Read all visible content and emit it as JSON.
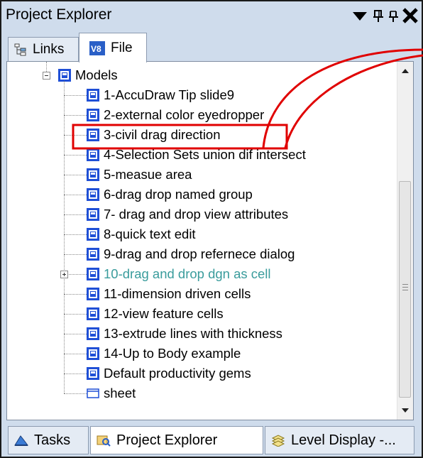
{
  "window": {
    "title": "Project Explorer",
    "icons": [
      "dropdown-arrow-icon",
      "pin-icon",
      "pin-icon",
      "close-icon"
    ]
  },
  "tabs_top": [
    {
      "label": "Links",
      "icon": "links-tree-icon",
      "selected": false
    },
    {
      "label": "File",
      "icon": "dgn-file-icon",
      "selected": true
    }
  ],
  "tree": {
    "root": {
      "label": "Models",
      "expanded": true
    },
    "items": [
      {
        "label": "1-AccuDraw Tip slide9"
      },
      {
        "label": "2-external color eyedropper"
      },
      {
        "label": "3-civil drag direction",
        "highlighted": true
      },
      {
        "label": "4-Selection Sets union dif intersect"
      },
      {
        "label": "5-measue area"
      },
      {
        "label": "6-drag drop named group"
      },
      {
        "label": "7- drag and drop view attributes"
      },
      {
        "label": "8-quick text edit"
      },
      {
        "label": "9-drag and drop refernece dialog"
      },
      {
        "label": "10-drag and drop dgn as cell",
        "has_children": true,
        "color": "#3a9c9c"
      },
      {
        "label": "11-dimension driven cells"
      },
      {
        "label": "12-view feature cells"
      },
      {
        "label": "13-extrude lines with thickness"
      },
      {
        "label": "14-Up to Body example"
      },
      {
        "label": "Default productivity gems"
      },
      {
        "label": "sheet",
        "icon": "sheet-icon"
      }
    ]
  },
  "tabs_bottom": [
    {
      "label": "Tasks",
      "icon": "tasks-icon"
    },
    {
      "label": "Project Explorer",
      "icon": "project-explorer-icon",
      "selected": true
    },
    {
      "label": "Level Display -...",
      "icon": "level-display-icon"
    }
  ],
  "colors": {
    "panel_bg": "#cfdcec",
    "highlight_red": "#e00000",
    "model_icon_blue": "#1f4fd6",
    "teal_text": "#3a9c9c"
  }
}
